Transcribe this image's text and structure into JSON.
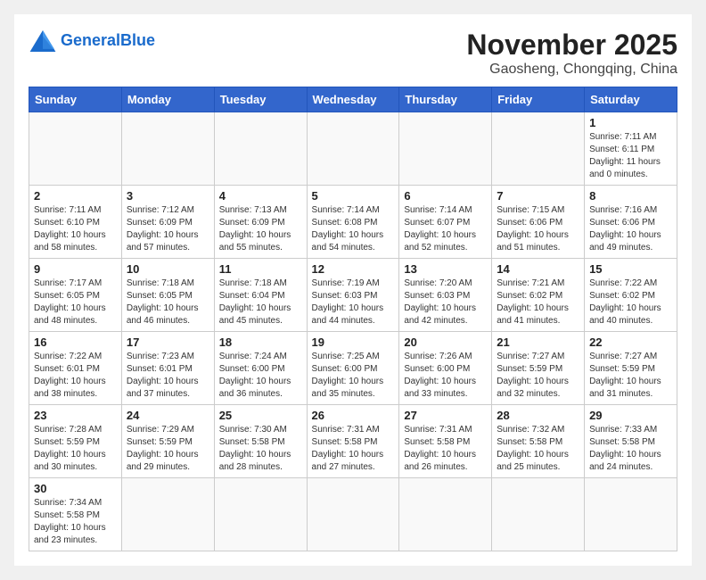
{
  "header": {
    "logo_general": "General",
    "logo_blue": "Blue",
    "month_title": "November 2025",
    "location": "Gaosheng, Chongqing, China"
  },
  "weekdays": [
    "Sunday",
    "Monday",
    "Tuesday",
    "Wednesday",
    "Thursday",
    "Friday",
    "Saturday"
  ],
  "weeks": [
    [
      {
        "day": "",
        "info": ""
      },
      {
        "day": "",
        "info": ""
      },
      {
        "day": "",
        "info": ""
      },
      {
        "day": "",
        "info": ""
      },
      {
        "day": "",
        "info": ""
      },
      {
        "day": "",
        "info": ""
      },
      {
        "day": "1",
        "info": "Sunrise: 7:11 AM\nSunset: 6:11 PM\nDaylight: 11 hours and 0 minutes."
      }
    ],
    [
      {
        "day": "2",
        "info": "Sunrise: 7:11 AM\nSunset: 6:10 PM\nDaylight: 10 hours and 58 minutes."
      },
      {
        "day": "3",
        "info": "Sunrise: 7:12 AM\nSunset: 6:09 PM\nDaylight: 10 hours and 57 minutes."
      },
      {
        "day": "4",
        "info": "Sunrise: 7:13 AM\nSunset: 6:09 PM\nDaylight: 10 hours and 55 minutes."
      },
      {
        "day": "5",
        "info": "Sunrise: 7:14 AM\nSunset: 6:08 PM\nDaylight: 10 hours and 54 minutes."
      },
      {
        "day": "6",
        "info": "Sunrise: 7:14 AM\nSunset: 6:07 PM\nDaylight: 10 hours and 52 minutes."
      },
      {
        "day": "7",
        "info": "Sunrise: 7:15 AM\nSunset: 6:06 PM\nDaylight: 10 hours and 51 minutes."
      },
      {
        "day": "8",
        "info": "Sunrise: 7:16 AM\nSunset: 6:06 PM\nDaylight: 10 hours and 49 minutes."
      }
    ],
    [
      {
        "day": "9",
        "info": "Sunrise: 7:17 AM\nSunset: 6:05 PM\nDaylight: 10 hours and 48 minutes."
      },
      {
        "day": "10",
        "info": "Sunrise: 7:18 AM\nSunset: 6:05 PM\nDaylight: 10 hours and 46 minutes."
      },
      {
        "day": "11",
        "info": "Sunrise: 7:18 AM\nSunset: 6:04 PM\nDaylight: 10 hours and 45 minutes."
      },
      {
        "day": "12",
        "info": "Sunrise: 7:19 AM\nSunset: 6:03 PM\nDaylight: 10 hours and 44 minutes."
      },
      {
        "day": "13",
        "info": "Sunrise: 7:20 AM\nSunset: 6:03 PM\nDaylight: 10 hours and 42 minutes."
      },
      {
        "day": "14",
        "info": "Sunrise: 7:21 AM\nSunset: 6:02 PM\nDaylight: 10 hours and 41 minutes."
      },
      {
        "day": "15",
        "info": "Sunrise: 7:22 AM\nSunset: 6:02 PM\nDaylight: 10 hours and 40 minutes."
      }
    ],
    [
      {
        "day": "16",
        "info": "Sunrise: 7:22 AM\nSunset: 6:01 PM\nDaylight: 10 hours and 38 minutes."
      },
      {
        "day": "17",
        "info": "Sunrise: 7:23 AM\nSunset: 6:01 PM\nDaylight: 10 hours and 37 minutes."
      },
      {
        "day": "18",
        "info": "Sunrise: 7:24 AM\nSunset: 6:00 PM\nDaylight: 10 hours and 36 minutes."
      },
      {
        "day": "19",
        "info": "Sunrise: 7:25 AM\nSunset: 6:00 PM\nDaylight: 10 hours and 35 minutes."
      },
      {
        "day": "20",
        "info": "Sunrise: 7:26 AM\nSunset: 6:00 PM\nDaylight: 10 hours and 33 minutes."
      },
      {
        "day": "21",
        "info": "Sunrise: 7:27 AM\nSunset: 5:59 PM\nDaylight: 10 hours and 32 minutes."
      },
      {
        "day": "22",
        "info": "Sunrise: 7:27 AM\nSunset: 5:59 PM\nDaylight: 10 hours and 31 minutes."
      }
    ],
    [
      {
        "day": "23",
        "info": "Sunrise: 7:28 AM\nSunset: 5:59 PM\nDaylight: 10 hours and 30 minutes."
      },
      {
        "day": "24",
        "info": "Sunrise: 7:29 AM\nSunset: 5:59 PM\nDaylight: 10 hours and 29 minutes."
      },
      {
        "day": "25",
        "info": "Sunrise: 7:30 AM\nSunset: 5:58 PM\nDaylight: 10 hours and 28 minutes."
      },
      {
        "day": "26",
        "info": "Sunrise: 7:31 AM\nSunset: 5:58 PM\nDaylight: 10 hours and 27 minutes."
      },
      {
        "day": "27",
        "info": "Sunrise: 7:31 AM\nSunset: 5:58 PM\nDaylight: 10 hours and 26 minutes."
      },
      {
        "day": "28",
        "info": "Sunrise: 7:32 AM\nSunset: 5:58 PM\nDaylight: 10 hours and 25 minutes."
      },
      {
        "day": "29",
        "info": "Sunrise: 7:33 AM\nSunset: 5:58 PM\nDaylight: 10 hours and 24 minutes."
      }
    ],
    [
      {
        "day": "30",
        "info": "Sunrise: 7:34 AM\nSunset: 5:58 PM\nDaylight: 10 hours and 23 minutes."
      },
      {
        "day": "",
        "info": ""
      },
      {
        "day": "",
        "info": ""
      },
      {
        "day": "",
        "info": ""
      },
      {
        "day": "",
        "info": ""
      },
      {
        "day": "",
        "info": ""
      },
      {
        "day": "",
        "info": ""
      }
    ]
  ]
}
